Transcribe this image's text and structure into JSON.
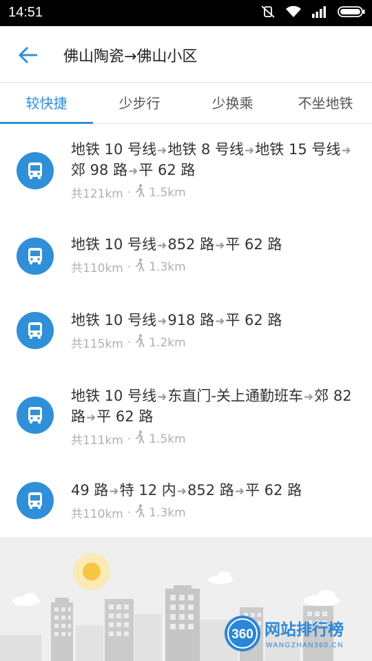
{
  "status_bar": {
    "time": "14:51"
  },
  "header": {
    "title": "佛山陶瓷→佛山小区"
  },
  "tabs": [
    {
      "label": "较快捷",
      "active": true
    },
    {
      "label": "少步行",
      "active": false
    },
    {
      "label": "少换乘",
      "active": false
    },
    {
      "label": "不坐地铁",
      "active": false
    }
  ],
  "routes": [
    {
      "segments": [
        "地铁 10 号线",
        "地铁 8 号线",
        "地铁 15 号线",
        "郊 98 路",
        "平 62 路"
      ],
      "total": "共121km",
      "walk": "1.5km"
    },
    {
      "segments": [
        "地铁 10 号线",
        "852 路",
        "平 62 路"
      ],
      "total": "共110km",
      "walk": "1.3km"
    },
    {
      "segments": [
        "地铁 10 号线",
        "918 路",
        "平 62 路"
      ],
      "total": "共115km",
      "walk": "1.2km"
    },
    {
      "segments": [
        "地铁 10 号线",
        "东直门-关上通勤班车",
        "郊 82 路",
        "平 62 路"
      ],
      "total": "共111km",
      "walk": "1.5km"
    },
    {
      "segments": [
        "49 路",
        "特 12 内",
        "852 路",
        "平 62 路"
      ],
      "total": "共110km",
      "walk": "1.3km"
    }
  ],
  "watermark": {
    "logo_number": "360",
    "brand": "网站排行榜",
    "site": "WANGZHAN360.CN"
  },
  "colors": {
    "accent": "#2f8fd8",
    "meta_gray": "#b0b0b0"
  }
}
